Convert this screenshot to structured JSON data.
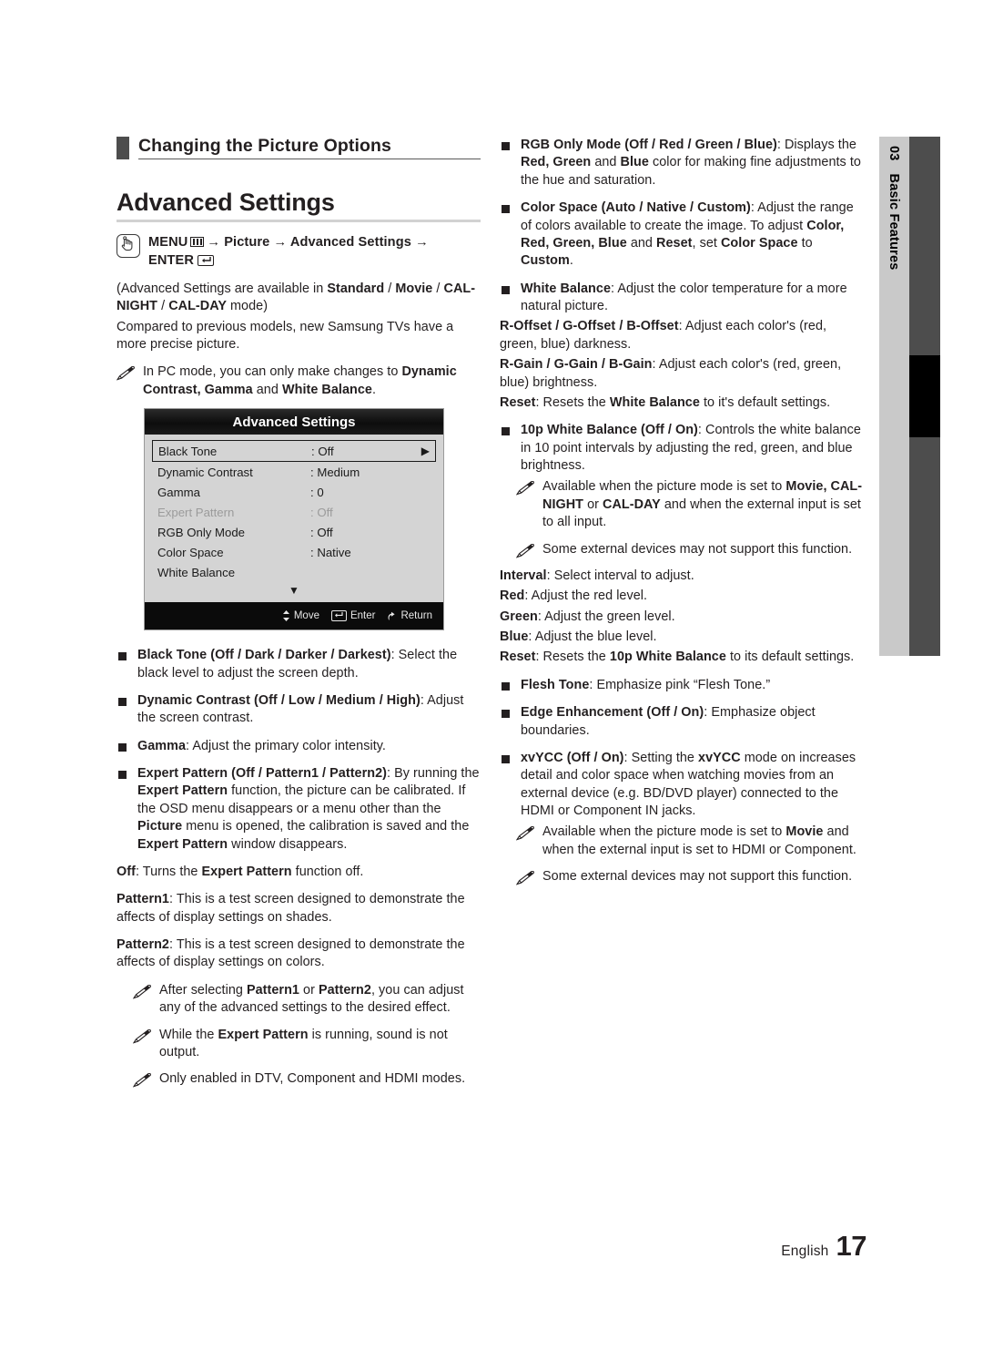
{
  "chapter_tab": {
    "number": "03",
    "label": "Basic Features"
  },
  "section": {
    "title": "Changing the Picture Options"
  },
  "heading": {
    "title": "Advanced Settings"
  },
  "menu_path": {
    "line1_a": "MENU",
    "menu_icon": "menu-grid-icon",
    "line1_b": "→ Picture → Advanced Settings →",
    "line2": "ENTER",
    "enter_icon": "enter-key-icon",
    "hand_icon": "hand-press-icon"
  },
  "intro": {
    "avail_a": "(Advanced Settings are available in ",
    "avail_b": "Standard",
    "avail_c": " / ",
    "avail_d": "Movie",
    "avail_e": " / ",
    "avail_f": "CAL-NIGHT",
    "avail_g": " / ",
    "avail_h": "CAL-DAY",
    "avail_i": " mode)",
    "compare": "Compared to previous models, new Samsung TVs have a more precise picture.",
    "pc_note_a": "In PC mode, you can only make changes to ",
    "pc_note_b": "Dynamic Contrast, Gamma",
    "pc_note_c": " and ",
    "pc_note_d": "White Balance",
    "pc_note_e": "."
  },
  "osd": {
    "title": "Advanced Settings",
    "rows": [
      {
        "label": "Black Tone",
        "value": ": Off",
        "selected": true,
        "dimmed": false,
        "arrow": "▶"
      },
      {
        "label": "Dynamic Contrast",
        "value": ": Medium",
        "selected": false,
        "dimmed": false,
        "arrow": ""
      },
      {
        "label": "Gamma",
        "value": ": 0",
        "selected": false,
        "dimmed": false,
        "arrow": ""
      },
      {
        "label": "Expert Pattern",
        "value": ": Off",
        "selected": false,
        "dimmed": true,
        "arrow": ""
      },
      {
        "label": "RGB Only Mode",
        "value": ": Off",
        "selected": false,
        "dimmed": false,
        "arrow": ""
      },
      {
        "label": "Color Space",
        "value": ": Native",
        "selected": false,
        "dimmed": false,
        "arrow": ""
      },
      {
        "label": "White Balance",
        "value": "",
        "selected": false,
        "dimmed": false,
        "arrow": ""
      }
    ],
    "scroll_down": "▼",
    "footer": {
      "move": "Move",
      "enter": "Enter",
      "return": "Return",
      "return_icon": "return-arrow-icon",
      "move_icon": "up-down-arrow-icon",
      "enter_icon": "enter-key-icon"
    }
  },
  "left_items": {
    "black_tone_title": "Black Tone (Off / Dark / Darker / Darkest)",
    "black_tone_body": ": Select the black level to adjust the screen depth.",
    "dyn_title": "Dynamic Contrast (Off / Low / Medium / High)",
    "dyn_body": ": Adjust the screen contrast.",
    "gamma_title": "Gamma",
    "gamma_body": ": Adjust the primary color intensity.",
    "expert_title": "Expert Pattern (Off / Pattern1 / Pattern2)",
    "expert_body_1": ": By running the ",
    "expert_body_2": "Expert Pattern",
    "expert_body_3": " function, the picture can be calibrated. If the OSD menu disappears or a menu other than the ",
    "expert_body_4": "Picture",
    "expert_body_5": " menu is opened, the calibration is saved and the ",
    "expert_body_6": "Expert Pattern",
    "expert_body_7": " window disappears.",
    "off_label": "Off",
    "off_text_a": ": Turns the ",
    "off_text_b": "Expert Pattern",
    "off_text_c": " function off.",
    "p1_label": "Pattern1",
    "p1_text": ": This is a test screen designed to demonstrate the affects of display settings on shades.",
    "p2_label": "Pattern2",
    "p2_text": ": This is a test screen designed to demonstrate the affects of display settings on colors.",
    "note1_a": "After selecting ",
    "note1_b": "Pattern1",
    "note1_c": " or ",
    "note1_d": "Pattern2",
    "note1_e": ", you can adjust any of the advanced settings to the desired effect.",
    "note2_a": "While the ",
    "note2_b": "Expert Pattern",
    "note2_c": " is running, sound is not output.",
    "note3": "Only enabled in DTV, Component and HDMI modes."
  },
  "right_items": {
    "rgb_title": "RGB Only Mode (Off / Red / Green / Blue)",
    "rgb_body_a": ": Displays the ",
    "rgb_body_b": "Red, Green",
    "rgb_body_c": " and ",
    "rgb_body_d": "Blue",
    "rgb_body_e": " color for making fine adjustments to the hue and saturation.",
    "cs_title": "Color Space (Auto / Native / Custom)",
    "cs_body_a": ": Adjust the range of colors available to create the image. To adjust ",
    "cs_body_b": "Color, Red, Green, Blue",
    "cs_body_c": " and ",
    "cs_body_d": "Reset",
    "cs_body_e": ", set ",
    "cs_body_f": "Color Space",
    "cs_body_g": " to ",
    "cs_body_h": "Custom",
    "cs_body_i": ".",
    "wb_title": "White Balance",
    "wb_body": ": Adjust the color temperature for a more natural picture.",
    "offset_label": "R-Offset / G-Offset / B-Offset",
    "offset_text": ": Adjust each color's (red, green, blue) darkness.",
    "gain_label": "R-Gain / G-Gain / B-Gain",
    "gain_text": ": Adjust each color's (red, green, blue) brightness.",
    "reset_label": "Reset",
    "reset_text_a": ": Resets the ",
    "reset_text_b": "White Balance",
    "reset_text_c": " to it's default settings.",
    "tenp_title": "10p White Balance (Off / On)",
    "tenp_body": ": Controls the white balance in 10 point intervals by adjusting the red, green, and blue brightness.",
    "tenp_note1_a": "Available when the picture mode is set to ",
    "tenp_note1_b": "Movie, CAL-NIGHT",
    "tenp_note1_c": " or ",
    "tenp_note1_d": "CAL-DAY",
    "tenp_note1_e": " and when the external input is set to all input.",
    "tenp_note2": "Some external devices may not support this function.",
    "interval_label": "Interval",
    "interval_text": ": Select interval to adjust.",
    "red_label": "Red",
    "red_text": ": Adjust the red level.",
    "green_label": "Green",
    "green_text": ": Adjust the green level.",
    "blue_label": "Blue",
    "blue_text": ": Adjust the blue level.",
    "reset2_label": "Reset",
    "reset2_text_a": ": Resets the ",
    "reset2_text_b": "10p White Balance",
    "reset2_text_c": " to its default settings.",
    "flesh_title": "Flesh Tone",
    "flesh_body": ": Emphasize pink “Flesh Tone.”",
    "edge_title": "Edge Enhancement (Off / On)",
    "edge_body": ": Emphasize object boundaries.",
    "xvycc_title": "xvYCC (Off / On)",
    "xvycc_body_a": ": Setting the ",
    "xvycc_body_b": "xvYCC",
    "xvycc_body_c": " mode on increases detail and color space when watching movies from an external device (e.g. BD/DVD player) connected to the HDMI or Component IN jacks.",
    "xvycc_note1_a": "Available when the picture mode is set to ",
    "xvycc_note1_b": "Movie",
    "xvycc_note1_c": " and when the external input is set to HDMI or Component.",
    "xvycc_note2": "Some external devices may not support this function."
  },
  "footer": {
    "language": "English",
    "page": "17"
  }
}
